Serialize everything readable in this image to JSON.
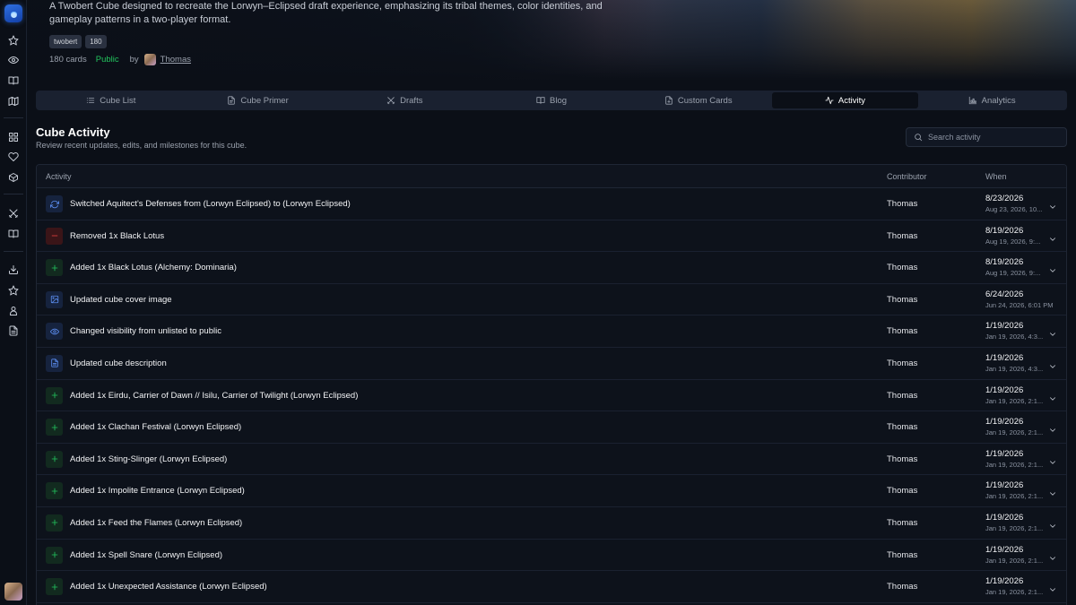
{
  "hero": {
    "description": "A Twobert Cube designed to recreate the Lorwyn–Eclipsed draft experience, emphasizing its tribal themes, color identities, and gameplay patterns in a two-player format.",
    "tags": [
      "twobert",
      "180"
    ],
    "card_count": "180 cards",
    "visibility": "Public",
    "by_label": "by",
    "author": "Thomas"
  },
  "tabs": [
    {
      "label": "Cube List",
      "icon": "list-icon"
    },
    {
      "label": "Cube Primer",
      "icon": "file-icon"
    },
    {
      "label": "Drafts",
      "icon": "swords-icon"
    },
    {
      "label": "Blog",
      "icon": "book-icon"
    },
    {
      "label": "Custom Cards",
      "icon": "file-plus-icon"
    },
    {
      "label": "Activity",
      "icon": "activity-icon",
      "active": true
    },
    {
      "label": "Analytics",
      "icon": "bar-chart-icon"
    }
  ],
  "section": {
    "title": "Cube Activity",
    "subtitle": "Review recent updates, edits, and milestones for this cube.",
    "search_placeholder": "Search activity"
  },
  "table": {
    "headers": {
      "activity": "Activity",
      "contributor": "Contributor",
      "when": "When"
    },
    "rows": [
      {
        "type": "swap",
        "color": "blue",
        "text": "Switched Aquitect's Defenses from (Lorwyn Eclipsed) to (Lorwyn Eclipsed)",
        "contributor": "Thomas",
        "date": "8/23/2026",
        "full": "Aug 23, 2026, 10...",
        "expand": true
      },
      {
        "type": "remove",
        "color": "red",
        "text": "Removed 1x Black Lotus",
        "contributor": "Thomas",
        "date": "8/19/2026",
        "full": "Aug 19, 2026, 9:...",
        "expand": true
      },
      {
        "type": "add",
        "color": "green",
        "text": "Added 1x Black Lotus (Alchemy: Dominaria)",
        "contributor": "Thomas",
        "date": "8/19/2026",
        "full": "Aug 19, 2026, 9:...",
        "expand": true
      },
      {
        "type": "image",
        "color": "blue",
        "text": "Updated cube cover image",
        "contributor": "Thomas",
        "date": "6/24/2026",
        "full": "Jun 24, 2026, 6:01 PM",
        "expand": false
      },
      {
        "type": "eye",
        "color": "blue",
        "text": "Changed visibility from unlisted to public",
        "contributor": "Thomas",
        "date": "1/19/2026",
        "full": "Jan 19, 2026, 4:3...",
        "expand": true
      },
      {
        "type": "doc",
        "color": "blue",
        "text": "Updated cube description",
        "contributor": "Thomas",
        "date": "1/19/2026",
        "full": "Jan 19, 2026, 4:3...",
        "expand": true
      },
      {
        "type": "add",
        "color": "green",
        "text": "Added 1x Eirdu, Carrier of Dawn // Isilu, Carrier of Twilight (Lorwyn Eclipsed)",
        "contributor": "Thomas",
        "date": "1/19/2026",
        "full": "Jan 19, 2026, 2:1...",
        "expand": true
      },
      {
        "type": "add",
        "color": "green",
        "text": "Added 1x Clachan Festival (Lorwyn Eclipsed)",
        "contributor": "Thomas",
        "date": "1/19/2026",
        "full": "Jan 19, 2026, 2:1...",
        "expand": true
      },
      {
        "type": "add",
        "color": "green",
        "text": "Added 1x Sting-Slinger (Lorwyn Eclipsed)",
        "contributor": "Thomas",
        "date": "1/19/2026",
        "full": "Jan 19, 2026, 2:1...",
        "expand": true
      },
      {
        "type": "add",
        "color": "green",
        "text": "Added 1x Impolite Entrance (Lorwyn Eclipsed)",
        "contributor": "Thomas",
        "date": "1/19/2026",
        "full": "Jan 19, 2026, 2:1...",
        "expand": true
      },
      {
        "type": "add",
        "color": "green",
        "text": "Added 1x Feed the Flames (Lorwyn Eclipsed)",
        "contributor": "Thomas",
        "date": "1/19/2026",
        "full": "Jan 19, 2026, 2:1...",
        "expand": true
      },
      {
        "type": "add",
        "color": "green",
        "text": "Added 1x Spell Snare (Lorwyn Eclipsed)",
        "contributor": "Thomas",
        "date": "1/19/2026",
        "full": "Jan 19, 2026, 2:1...",
        "expand": true
      },
      {
        "type": "add",
        "color": "green",
        "text": "Added 1x Unexpected Assistance (Lorwyn Eclipsed)",
        "contributor": "Thomas",
        "date": "1/19/2026",
        "full": "Jan 19, 2026, 2:1...",
        "expand": true
      }
    ]
  },
  "sidebar": {
    "icons": [
      "star-icon",
      "eye-icon",
      "book-open-icon",
      "map-icon",
      "grid-icon",
      "heart-icon",
      "package-icon",
      "swords-icon",
      "book-icon",
      "download-icon",
      "star-outline-icon",
      "user-icon",
      "document-icon"
    ]
  },
  "colors": {
    "accent": "#3b82f6",
    "public": "#22c55e",
    "remove": "#ef4444",
    "add": "#22c55e"
  }
}
